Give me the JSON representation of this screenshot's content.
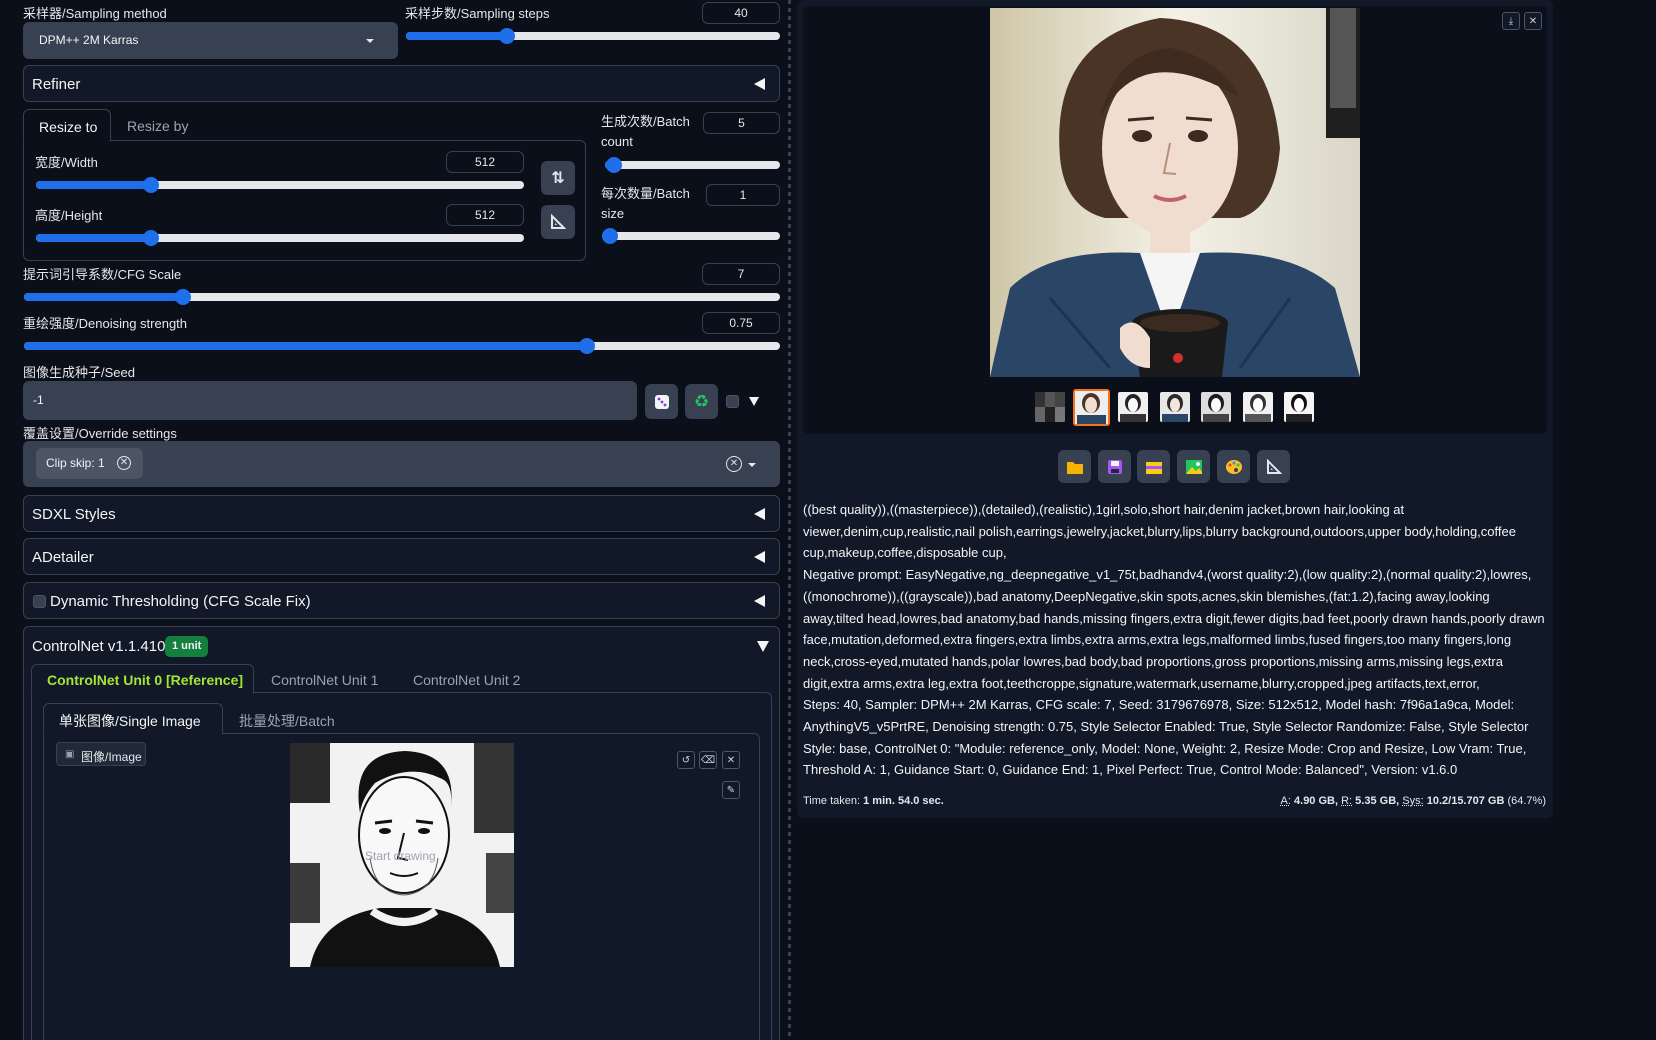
{
  "sampling": {
    "method_label": "采样器/Sampling method",
    "method_value": "DPM++ 2M Karras",
    "steps_label": "采样步数/Sampling steps",
    "steps_value": "40",
    "steps_fraction": 0.27
  },
  "refiner": {
    "title": "Refiner"
  },
  "resize": {
    "tab_resize_to": "Resize to",
    "tab_resize_by": "Resize by",
    "width_label": "宽度/Width",
    "width_value": "512",
    "width_fraction": 0.235,
    "height_label": "高度/Height",
    "height_value": "512",
    "height_fraction": 0.235
  },
  "batch": {
    "count_label_1": "生成次数/Batch",
    "count_label_2": "count",
    "count_value": "5",
    "count_fraction": 0.05,
    "size_label_1": "每次数量/Batch",
    "size_label_2": "size",
    "size_value": "1",
    "size_fraction": 0.0
  },
  "cfg": {
    "label": "提示词引导系数/CFG Scale",
    "value": "7",
    "fraction": 0.21
  },
  "denoise": {
    "label": "重绘强度/Denoising strength",
    "value": "0.75",
    "fraction": 0.745
  },
  "seed": {
    "label": "图像生成种子/Seed",
    "value": "-1"
  },
  "override": {
    "label": "覆盖设置/Override settings",
    "chip": "Clip skip: 1"
  },
  "accordions": {
    "sdxl": "SDXL Styles",
    "adetailer": "ADetailer",
    "dynamic": "Dynamic Thresholding (CFG Scale Fix)"
  },
  "controlnet": {
    "title": "ControlNet v1.1.410",
    "badge": "1 unit",
    "unit_tabs": [
      "ControlNet Unit 0 [Reference]",
      "ControlNet Unit 1",
      "ControlNet Unit 2"
    ],
    "image_tabs": [
      "单张图像/Single Image",
      "批量处理/Batch"
    ],
    "image_label": "图像/Image",
    "overlay_text": "Start drawing"
  },
  "output": {
    "prompt": "((best quality)),((masterpiece)),(detailed),(realistic),1girl,solo,short hair,denim jacket,brown hair,looking at viewer,denim,cup,realistic,nail polish,earrings,jewelry,jacket,blurry,lips,blurry background,outdoors,upper body,holding,coffee cup,makeup,coffee,disposable cup,",
    "negative": "Negative prompt: EasyNegative,ng_deepnegative_v1_75t,badhandv4,(worst quality:2),(low quality:2),(normal quality:2),lowres,((monochrome)),((grayscale)),bad anatomy,DeepNegative,skin spots,acnes,skin blemishes,(fat:1.2),facing away,looking away,tilted head,lowres,bad anatomy,bad hands,missing fingers,extra digit,fewer digits,bad feet,poorly drawn hands,poorly drawn face,mutation,deformed,extra fingers,extra limbs,extra arms,extra legs,malformed limbs,fused fingers,too many fingers,long neck,cross-eyed,mutated hands,polar lowres,bad body,bad proportions,gross proportions,missing arms,missing legs,extra digit,extra arms,extra leg,extra foot,teethcroppe,signature,watermark,username,blurry,cropped,jpeg artifacts,text,error,",
    "params": "Steps: 40, Sampler: DPM++ 2M Karras, CFG scale: 7, Seed: 3179676978, Size: 512x512, Model hash: 7f96a1a9ca, Model: AnythingV5_v5PrtRE, Denoising strength: 0.75, Style Selector Enabled: True, Style Selector Randomize: False, Style Selector Style: base, ControlNet 0: \"Module: reference_only, Model: None, Weight: 2, Resize Mode: Crop and Resize, Low Vram: True, Threshold A: 1, Guidance Start: 0, Guidance End: 1, Pixel Perfect: True, Control Mode: Balanced\", Version: v1.6.0",
    "time_label": "Time taken:",
    "time_value": "1 min. 54.0 sec.",
    "mem_a_label": "A:",
    "mem_a": "4.90 GB,",
    "mem_r_label": "R:",
    "mem_r": "5.35 GB,",
    "mem_sys_label": "Sys:",
    "mem_sys": "10.2/15.707 GB",
    "mem_pct": "(64.7%)"
  },
  "colors": {
    "accent": "#1f6feb",
    "badge": "#15803d",
    "tab_active": "#a3e635",
    "selected_thumb": "#f97316"
  }
}
